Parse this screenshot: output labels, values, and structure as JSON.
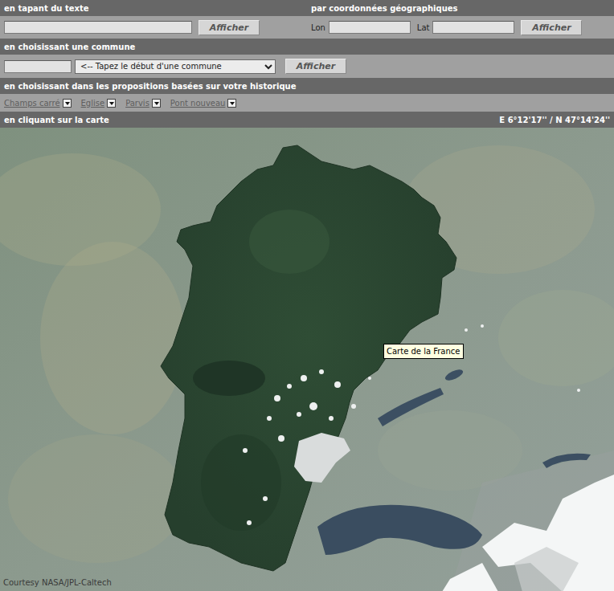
{
  "text_search": {
    "header": "en tapant du texte",
    "button": "Afficher"
  },
  "coord_search": {
    "header": "par coordonnées géographiques",
    "lon_label": "Lon",
    "lat_label": "Lat",
    "button": "Afficher"
  },
  "commune_search": {
    "header": "en choisissant une commune",
    "select": "<-- Tapez le début d'une commune",
    "button": "Afficher"
  },
  "history": {
    "header": "en choisissant dans les propositions basées sur votre historique",
    "items": [
      {
        "label": "Champs carré"
      },
      {
        "label": "Eglise"
      },
      {
        "label": "Parvis"
      },
      {
        "label": "Pont nouveau"
      }
    ]
  },
  "map": {
    "header": "en cliquant sur la carte",
    "coordinates": "E 6°12'17'' / N 47°14'24''",
    "tooltip": "Carte de la France",
    "credit": "Courtesy NASA/JPL-Caltech"
  }
}
